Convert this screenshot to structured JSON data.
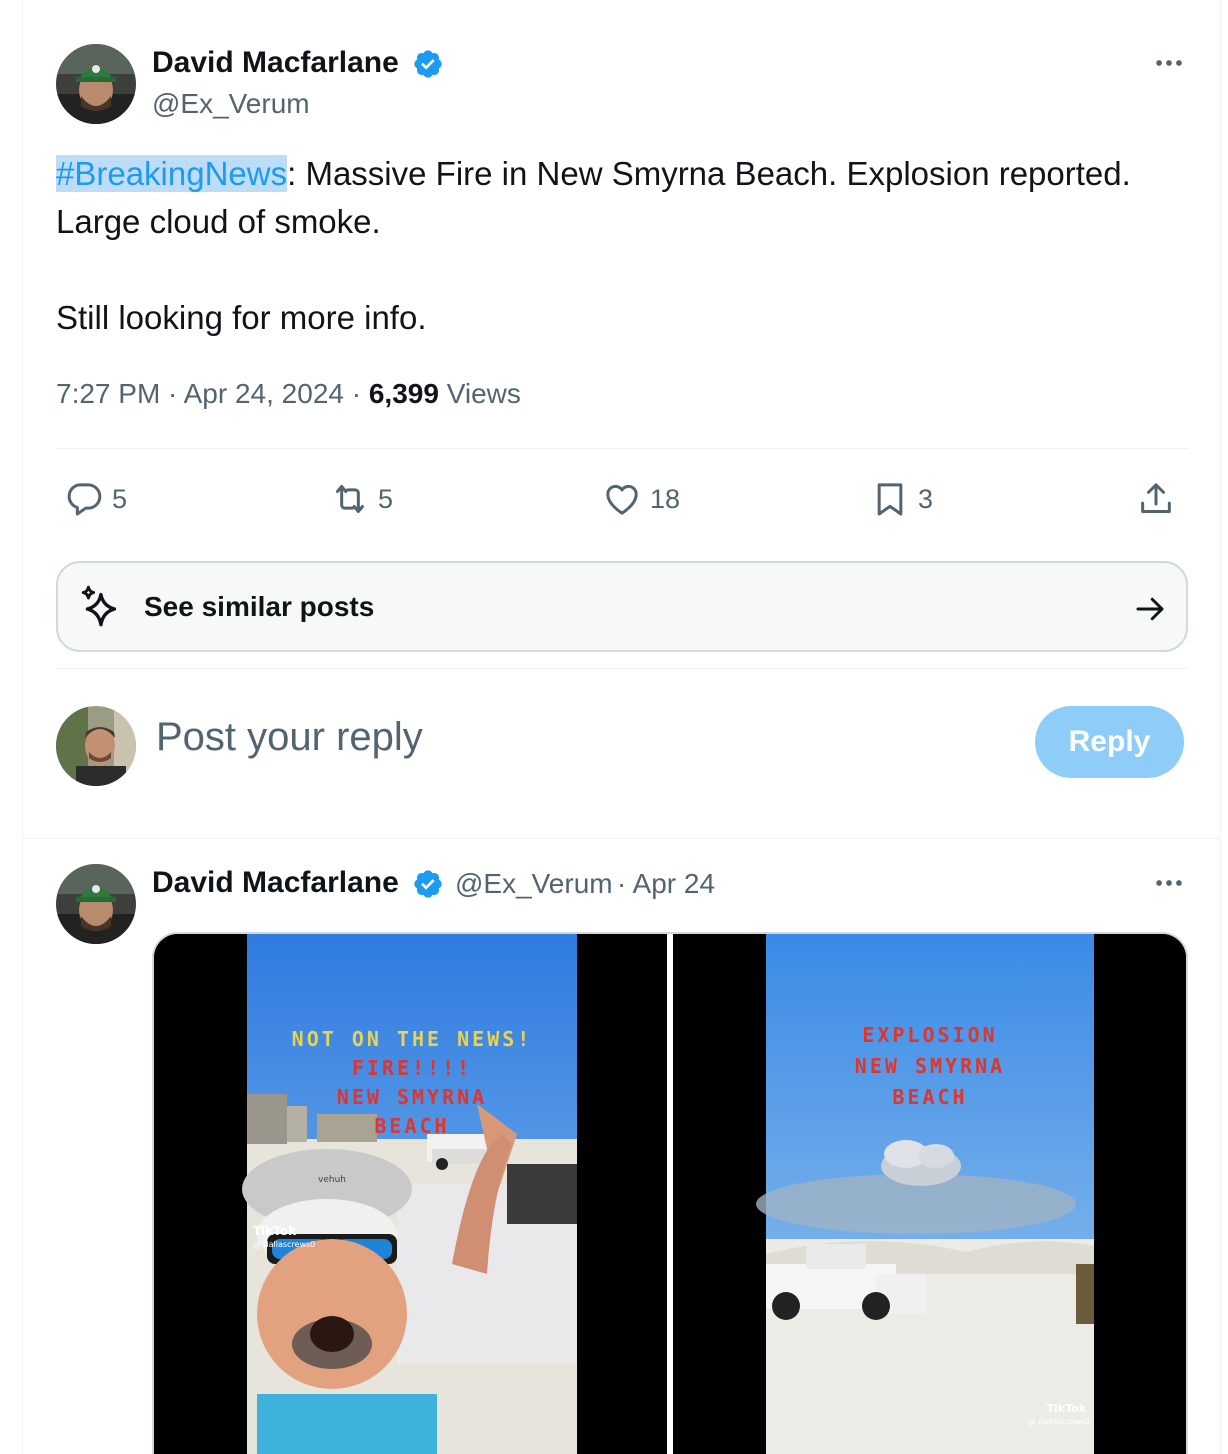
{
  "main_tweet": {
    "author_name": "David Macfarlane",
    "author_handle": "@Ex_Verum",
    "hashtag": "#BreakingNews",
    "text_after_hashtag": ": Massive Fire in New Smyrna Beach. Explosion reported. Large cloud of smoke.",
    "text_line_2": "Still looking for more info.",
    "time": "7:27 PM · Apr 24, 2024 · ",
    "views_count": "6,399",
    "views_label": " Views",
    "stats": {
      "replies": "5",
      "reposts": "5",
      "likes": "18",
      "bookmarks": "3"
    }
  },
  "similar_posts": {
    "label": "See similar posts"
  },
  "reply_box": {
    "placeholder": "Post your reply",
    "button_label": "Reply"
  },
  "reply_tweet": {
    "author_name": "David Macfarlane",
    "author_handle": "@Ex_Verum",
    "date": "· Apr 24",
    "video_1": {
      "overlay_line_1": "NOT ON THE NEWS!",
      "overlay_line_2": "FIRE!!!!",
      "overlay_line_3": "NEW SMYRNA",
      "overlay_line_4": "BEACH",
      "cap_brand": "vehuh",
      "watermark_brand": "TikTok",
      "watermark_user": "@ dallascrews0"
    },
    "video_2": {
      "overlay_line_1": "EXPLOSION",
      "overlay_line_2": "NEW SMYRNA",
      "overlay_line_3": "BEACH",
      "watermark_brand": "TikTok",
      "watermark_user": "@ dallascrews0"
    }
  },
  "colors": {
    "accent": "#1d9bf0",
    "hashtag_highlight": "#bcdcf7",
    "secondary_text": "#536471",
    "reply_button": "#8ecdf8",
    "overlay_yellow": "#e8d44d",
    "overlay_red": "#e0352b"
  },
  "icons": {
    "verified": "verified-badge-icon",
    "more": "more-horizontal-icon",
    "reply": "reply-bubble-icon",
    "repost": "repost-icon",
    "like": "heart-icon",
    "bookmark": "bookmark-icon",
    "share": "share-upload-icon",
    "sparkle": "sparkle-icon",
    "arrow": "arrow-right-icon"
  }
}
